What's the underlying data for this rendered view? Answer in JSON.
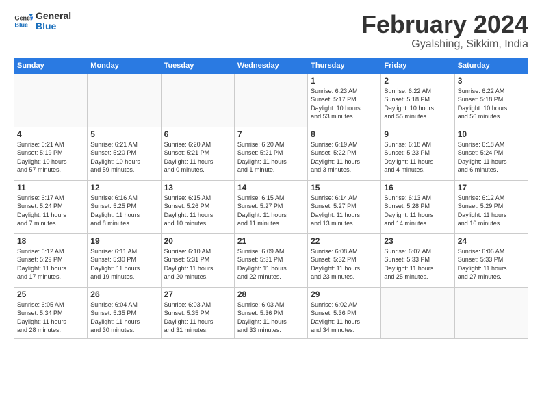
{
  "header": {
    "logo_general": "General",
    "logo_blue": "Blue",
    "month_title": "February 2024",
    "location": "Gyalshing, Sikkim, India"
  },
  "weekdays": [
    "Sunday",
    "Monday",
    "Tuesday",
    "Wednesday",
    "Thursday",
    "Friday",
    "Saturday"
  ],
  "weeks": [
    [
      {
        "day": "",
        "info": ""
      },
      {
        "day": "",
        "info": ""
      },
      {
        "day": "",
        "info": ""
      },
      {
        "day": "",
        "info": ""
      },
      {
        "day": "1",
        "info": "Sunrise: 6:23 AM\nSunset: 5:17 PM\nDaylight: 10 hours\nand 53 minutes."
      },
      {
        "day": "2",
        "info": "Sunrise: 6:22 AM\nSunset: 5:18 PM\nDaylight: 10 hours\nand 55 minutes."
      },
      {
        "day": "3",
        "info": "Sunrise: 6:22 AM\nSunset: 5:18 PM\nDaylight: 10 hours\nand 56 minutes."
      }
    ],
    [
      {
        "day": "4",
        "info": "Sunrise: 6:21 AM\nSunset: 5:19 PM\nDaylight: 10 hours\nand 57 minutes."
      },
      {
        "day": "5",
        "info": "Sunrise: 6:21 AM\nSunset: 5:20 PM\nDaylight: 10 hours\nand 59 minutes."
      },
      {
        "day": "6",
        "info": "Sunrise: 6:20 AM\nSunset: 5:21 PM\nDaylight: 11 hours\nand 0 minutes."
      },
      {
        "day": "7",
        "info": "Sunrise: 6:20 AM\nSunset: 5:21 PM\nDaylight: 11 hours\nand 1 minute."
      },
      {
        "day": "8",
        "info": "Sunrise: 6:19 AM\nSunset: 5:22 PM\nDaylight: 11 hours\nand 3 minutes."
      },
      {
        "day": "9",
        "info": "Sunrise: 6:18 AM\nSunset: 5:23 PM\nDaylight: 11 hours\nand 4 minutes."
      },
      {
        "day": "10",
        "info": "Sunrise: 6:18 AM\nSunset: 5:24 PM\nDaylight: 11 hours\nand 6 minutes."
      }
    ],
    [
      {
        "day": "11",
        "info": "Sunrise: 6:17 AM\nSunset: 5:24 PM\nDaylight: 11 hours\nand 7 minutes."
      },
      {
        "day": "12",
        "info": "Sunrise: 6:16 AM\nSunset: 5:25 PM\nDaylight: 11 hours\nand 8 minutes."
      },
      {
        "day": "13",
        "info": "Sunrise: 6:15 AM\nSunset: 5:26 PM\nDaylight: 11 hours\nand 10 minutes."
      },
      {
        "day": "14",
        "info": "Sunrise: 6:15 AM\nSunset: 5:27 PM\nDaylight: 11 hours\nand 11 minutes."
      },
      {
        "day": "15",
        "info": "Sunrise: 6:14 AM\nSunset: 5:27 PM\nDaylight: 11 hours\nand 13 minutes."
      },
      {
        "day": "16",
        "info": "Sunrise: 6:13 AM\nSunset: 5:28 PM\nDaylight: 11 hours\nand 14 minutes."
      },
      {
        "day": "17",
        "info": "Sunrise: 6:12 AM\nSunset: 5:29 PM\nDaylight: 11 hours\nand 16 minutes."
      }
    ],
    [
      {
        "day": "18",
        "info": "Sunrise: 6:12 AM\nSunset: 5:29 PM\nDaylight: 11 hours\nand 17 minutes."
      },
      {
        "day": "19",
        "info": "Sunrise: 6:11 AM\nSunset: 5:30 PM\nDaylight: 11 hours\nand 19 minutes."
      },
      {
        "day": "20",
        "info": "Sunrise: 6:10 AM\nSunset: 5:31 PM\nDaylight: 11 hours\nand 20 minutes."
      },
      {
        "day": "21",
        "info": "Sunrise: 6:09 AM\nSunset: 5:31 PM\nDaylight: 11 hours\nand 22 minutes."
      },
      {
        "day": "22",
        "info": "Sunrise: 6:08 AM\nSunset: 5:32 PM\nDaylight: 11 hours\nand 23 minutes."
      },
      {
        "day": "23",
        "info": "Sunrise: 6:07 AM\nSunset: 5:33 PM\nDaylight: 11 hours\nand 25 minutes."
      },
      {
        "day": "24",
        "info": "Sunrise: 6:06 AM\nSunset: 5:33 PM\nDaylight: 11 hours\nand 27 minutes."
      }
    ],
    [
      {
        "day": "25",
        "info": "Sunrise: 6:05 AM\nSunset: 5:34 PM\nDaylight: 11 hours\nand 28 minutes."
      },
      {
        "day": "26",
        "info": "Sunrise: 6:04 AM\nSunset: 5:35 PM\nDaylight: 11 hours\nand 30 minutes."
      },
      {
        "day": "27",
        "info": "Sunrise: 6:03 AM\nSunset: 5:35 PM\nDaylight: 11 hours\nand 31 minutes."
      },
      {
        "day": "28",
        "info": "Sunrise: 6:03 AM\nSunset: 5:36 PM\nDaylight: 11 hours\nand 33 minutes."
      },
      {
        "day": "29",
        "info": "Sunrise: 6:02 AM\nSunset: 5:36 PM\nDaylight: 11 hours\nand 34 minutes."
      },
      {
        "day": "",
        "info": ""
      },
      {
        "day": "",
        "info": ""
      }
    ]
  ]
}
